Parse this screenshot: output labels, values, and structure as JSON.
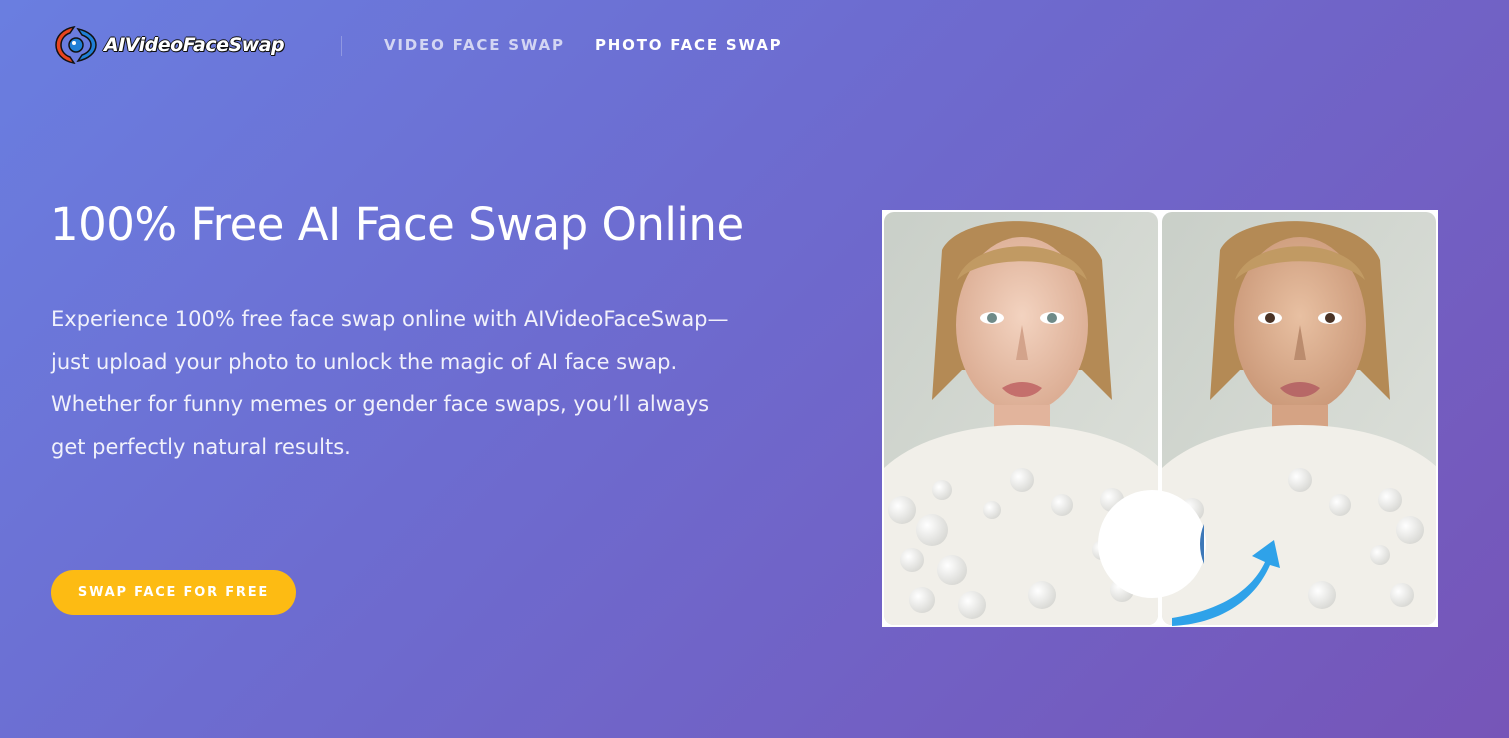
{
  "header": {
    "logo_text": "AIVideoFaceSwap",
    "nav": [
      {
        "label": "VIDEO FACE SWAP",
        "active": false
      },
      {
        "label": "PHOTO FACE SWAP",
        "active": true
      }
    ]
  },
  "hero": {
    "title": "100% Free AI Face Swap Online",
    "description": "Experience 100% free face swap online with AIVideoFaceSwap—just upload your photo to unlock the magic of AI face swap. Whether for funny memes or gender face swaps, you’ll always get perfectly natural results.",
    "cta_label": "SWAP FACE FOR FREE"
  },
  "colors": {
    "gradient_start": "#6a7ee0",
    "gradient_end": "#7655b8",
    "cta": "#fdbb13",
    "arrow": "#1e9be8"
  },
  "icons": [
    "logo-icon",
    "swap-arrow-icon"
  ]
}
